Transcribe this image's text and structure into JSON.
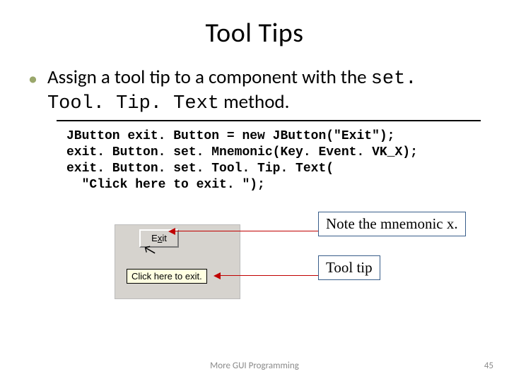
{
  "title": "Tool Tips",
  "bullet": {
    "pre": "Assign a tool tip to a component with the ",
    "code": "set. Tool. Tip. Text",
    "post": " method."
  },
  "code": {
    "l1": "JButton exit. Button = new JButton(\"Exit\");",
    "l2": "exit. Button. set. Mnemonic(Key. Event. VK_X);",
    "l3": "exit. Button. set. Tool. Tip. Text(",
    "l4": "  \"Click here to exit. \");"
  },
  "gui": {
    "button_pre": "E",
    "button_mnemonic": "x",
    "button_post": "it",
    "tooltip": "Click here to exit."
  },
  "callouts": {
    "note_mnemonic": "Note the mnemonic x.",
    "tool_tip": "Tool tip"
  },
  "footer": {
    "center": "More GUI Programming",
    "page": "45"
  }
}
